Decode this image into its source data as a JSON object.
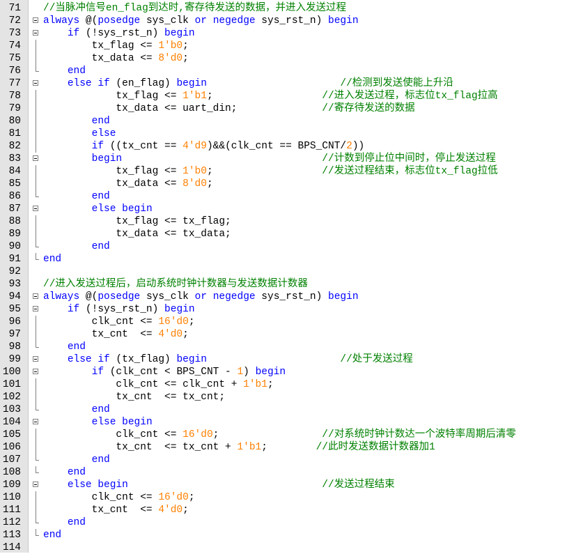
{
  "editor": {
    "language": "verilog",
    "colors": {
      "keyword": "#0000ff",
      "number": "#ff8000",
      "comment": "#008000",
      "text": "#000000",
      "gutter": "#e4e4e4"
    },
    "lines": [
      {
        "n": "71",
        "fold": "none",
        "tokens": [
          [
            "cm",
            "//当脉冲信号en_flag到达时,寄存待发送的数据，并进入发送过程"
          ]
        ]
      },
      {
        "n": "72",
        "fold": "open",
        "tokens": [
          [
            "kw",
            "always"
          ],
          [
            "t",
            " @("
          ],
          [
            "kw",
            "posedge"
          ],
          [
            "t",
            " sys_clk "
          ],
          [
            "kw",
            "or"
          ],
          [
            "t",
            " "
          ],
          [
            "kw",
            "negedge"
          ],
          [
            "t",
            " sys_rst_n) "
          ],
          [
            "kw",
            "begin"
          ]
        ]
      },
      {
        "n": "73",
        "fold": "open",
        "tokens": [
          [
            "t",
            "    "
          ],
          [
            "kw",
            "if"
          ],
          [
            "t",
            " (!sys_rst_n) "
          ],
          [
            "kw",
            "begin"
          ]
        ]
      },
      {
        "n": "74",
        "fold": "line",
        "tokens": [
          [
            "t",
            "        tx_flag <= "
          ],
          [
            "num",
            "1'b0"
          ],
          [
            "t",
            ";"
          ]
        ]
      },
      {
        "n": "75",
        "fold": "line",
        "tokens": [
          [
            "t",
            "        tx_data <= "
          ],
          [
            "num",
            "8'd0"
          ],
          [
            "t",
            ";"
          ]
        ]
      },
      {
        "n": "76",
        "fold": "end",
        "tokens": [
          [
            "t",
            "    "
          ],
          [
            "kw",
            "end"
          ]
        ]
      },
      {
        "n": "77",
        "fold": "open",
        "tokens": [
          [
            "t",
            "    "
          ],
          [
            "kw",
            "else if"
          ],
          [
            "t",
            " (en_flag) "
          ],
          [
            "kw",
            "begin"
          ],
          [
            "t",
            "                      "
          ],
          [
            "cm",
            "//检测到发送使能上升沿"
          ]
        ]
      },
      {
        "n": "78",
        "fold": "line",
        "tokens": [
          [
            "t",
            "            tx_flag <= "
          ],
          [
            "num",
            "1'b1"
          ],
          [
            "t",
            ";                  "
          ],
          [
            "cm",
            "//进入发送过程，标志位tx_flag拉高"
          ]
        ]
      },
      {
        "n": "79",
        "fold": "line",
        "tokens": [
          [
            "t",
            "            tx_data <= uart_din;              "
          ],
          [
            "cm",
            "//寄存待发送的数据"
          ]
        ]
      },
      {
        "n": "80",
        "fold": "line",
        "tokens": [
          [
            "t",
            "        "
          ],
          [
            "kw",
            "end"
          ]
        ]
      },
      {
        "n": "81",
        "fold": "line",
        "tokens": [
          [
            "t",
            "        "
          ],
          [
            "kw",
            "else"
          ]
        ]
      },
      {
        "n": "82",
        "fold": "line",
        "tokens": [
          [
            "t",
            "        "
          ],
          [
            "kw",
            "if"
          ],
          [
            "t",
            " ((tx_cnt == "
          ],
          [
            "num",
            "4'd9"
          ],
          [
            "t",
            ")&&(clk_cnt == BPS_CNT/"
          ],
          [
            "num",
            "2"
          ],
          [
            "t",
            "))"
          ]
        ]
      },
      {
        "n": "83",
        "fold": "open",
        "tokens": [
          [
            "t",
            "        "
          ],
          [
            "kw",
            "begin"
          ],
          [
            "t",
            "                                 "
          ],
          [
            "cm",
            "//计数到停止位中间时，停止发送过程"
          ]
        ]
      },
      {
        "n": "84",
        "fold": "line",
        "tokens": [
          [
            "t",
            "            tx_flag <= "
          ],
          [
            "num",
            "1'b0"
          ],
          [
            "t",
            ";                  "
          ],
          [
            "cm",
            "//发送过程结束，标志位tx_flag拉低"
          ]
        ]
      },
      {
        "n": "85",
        "fold": "line",
        "tokens": [
          [
            "t",
            "            tx_data <= "
          ],
          [
            "num",
            "8'd0"
          ],
          [
            "t",
            ";"
          ]
        ]
      },
      {
        "n": "86",
        "fold": "end",
        "tokens": [
          [
            "t",
            "        "
          ],
          [
            "kw",
            "end"
          ]
        ]
      },
      {
        "n": "87",
        "fold": "open",
        "tokens": [
          [
            "t",
            "        "
          ],
          [
            "kw",
            "else begin"
          ]
        ]
      },
      {
        "n": "88",
        "fold": "line",
        "tokens": [
          [
            "t",
            "            tx_flag <= tx_flag;"
          ]
        ]
      },
      {
        "n": "89",
        "fold": "line",
        "tokens": [
          [
            "t",
            "            tx_data <= tx_data;"
          ]
        ]
      },
      {
        "n": "90",
        "fold": "end",
        "tokens": [
          [
            "t",
            "        "
          ],
          [
            "kw",
            "end"
          ]
        ]
      },
      {
        "n": "91",
        "fold": "end",
        "tokens": [
          [
            "kw",
            "end"
          ]
        ]
      },
      {
        "n": "92",
        "fold": "none",
        "tokens": []
      },
      {
        "n": "93",
        "fold": "none",
        "tokens": [
          [
            "cm",
            "//进入发送过程后，启动系统时钟计数器与发送数据计数器"
          ]
        ]
      },
      {
        "n": "94",
        "fold": "open",
        "tokens": [
          [
            "kw",
            "always"
          ],
          [
            "t",
            " @("
          ],
          [
            "kw",
            "posedge"
          ],
          [
            "t",
            " sys_clk "
          ],
          [
            "kw",
            "or"
          ],
          [
            "t",
            " "
          ],
          [
            "kw",
            "negedge"
          ],
          [
            "t",
            " sys_rst_n) "
          ],
          [
            "kw",
            "begin"
          ]
        ]
      },
      {
        "n": "95",
        "fold": "open",
        "tokens": [
          [
            "t",
            "    "
          ],
          [
            "kw",
            "if"
          ],
          [
            "t",
            " (!sys_rst_n) "
          ],
          [
            "kw",
            "begin"
          ]
        ]
      },
      {
        "n": "96",
        "fold": "line",
        "tokens": [
          [
            "t",
            "        clk_cnt <= "
          ],
          [
            "num",
            "16'd0"
          ],
          [
            "t",
            ";"
          ]
        ]
      },
      {
        "n": "97",
        "fold": "line",
        "tokens": [
          [
            "t",
            "        tx_cnt  <= "
          ],
          [
            "num",
            "4'd0"
          ],
          [
            "t",
            ";"
          ]
        ]
      },
      {
        "n": "98",
        "fold": "end",
        "tokens": [
          [
            "t",
            "    "
          ],
          [
            "kw",
            "end"
          ]
        ]
      },
      {
        "n": "99",
        "fold": "open",
        "tokens": [
          [
            "t",
            "    "
          ],
          [
            "kw",
            "else if"
          ],
          [
            "t",
            " (tx_flag) "
          ],
          [
            "kw",
            "begin"
          ],
          [
            "t",
            "                      "
          ],
          [
            "cm",
            "//处于发送过程"
          ]
        ]
      },
      {
        "n": "100",
        "fold": "open",
        "tokens": [
          [
            "t",
            "        "
          ],
          [
            "kw",
            "if"
          ],
          [
            "t",
            " (clk_cnt < BPS_CNT - "
          ],
          [
            "num",
            "1"
          ],
          [
            "t",
            ") "
          ],
          [
            "kw",
            "begin"
          ]
        ]
      },
      {
        "n": "101",
        "fold": "line",
        "tokens": [
          [
            "t",
            "            clk_cnt <= clk_cnt + "
          ],
          [
            "num",
            "1'b1"
          ],
          [
            "t",
            ";"
          ]
        ]
      },
      {
        "n": "102",
        "fold": "line",
        "tokens": [
          [
            "t",
            "            tx_cnt  <= tx_cnt;"
          ]
        ]
      },
      {
        "n": "103",
        "fold": "end",
        "tokens": [
          [
            "t",
            "        "
          ],
          [
            "kw",
            "end"
          ]
        ]
      },
      {
        "n": "104",
        "fold": "open",
        "tokens": [
          [
            "t",
            "        "
          ],
          [
            "kw",
            "else begin"
          ]
        ]
      },
      {
        "n": "105",
        "fold": "line",
        "tokens": [
          [
            "t",
            "            clk_cnt <= "
          ],
          [
            "num",
            "16'd0"
          ],
          [
            "t",
            ";                 "
          ],
          [
            "cm",
            "//对系统时钟计数达一个波特率周期后清零"
          ]
        ]
      },
      {
        "n": "106",
        "fold": "line",
        "tokens": [
          [
            "t",
            "            tx_cnt  <= tx_cnt + "
          ],
          [
            "num",
            "1'b1"
          ],
          [
            "t",
            ";        "
          ],
          [
            "cm",
            "//此时发送数据计数器加1"
          ]
        ]
      },
      {
        "n": "107",
        "fold": "end",
        "tokens": [
          [
            "t",
            "        "
          ],
          [
            "kw",
            "end"
          ]
        ]
      },
      {
        "n": "108",
        "fold": "end",
        "tokens": [
          [
            "t",
            "    "
          ],
          [
            "kw",
            "end"
          ]
        ]
      },
      {
        "n": "109",
        "fold": "open",
        "tokens": [
          [
            "t",
            "    "
          ],
          [
            "kw",
            "else begin"
          ],
          [
            "t",
            "                                "
          ],
          [
            "cm",
            "//发送过程结束"
          ]
        ]
      },
      {
        "n": "110",
        "fold": "line",
        "tokens": [
          [
            "t",
            "        clk_cnt <= "
          ],
          [
            "num",
            "16'd0"
          ],
          [
            "t",
            ";"
          ]
        ]
      },
      {
        "n": "111",
        "fold": "line",
        "tokens": [
          [
            "t",
            "        tx_cnt  <= "
          ],
          [
            "num",
            "4'd0"
          ],
          [
            "t",
            ";"
          ]
        ]
      },
      {
        "n": "112",
        "fold": "end",
        "tokens": [
          [
            "t",
            "    "
          ],
          [
            "kw",
            "end"
          ]
        ]
      },
      {
        "n": "113",
        "fold": "end",
        "tokens": [
          [
            "kw",
            "end"
          ]
        ]
      },
      {
        "n": "114",
        "fold": "none",
        "tokens": []
      }
    ]
  }
}
